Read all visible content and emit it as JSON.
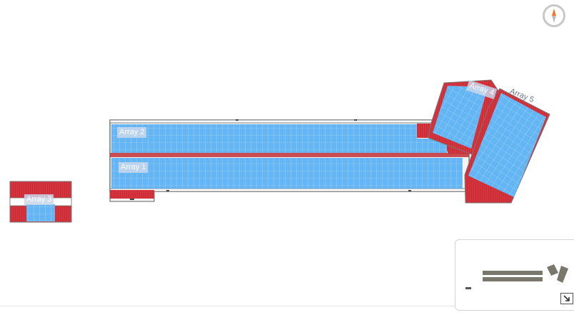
{
  "arrays": [
    {
      "label": "Array 1"
    },
    {
      "label": "Array 2"
    },
    {
      "label": "Array 3"
    },
    {
      "label": "Array 4"
    },
    {
      "label": "Array 5"
    }
  ],
  "colors": {
    "panel": "#63b6f3",
    "roof_red": "#d6333d",
    "frame": "#666666"
  },
  "icons": {
    "compass": "compass-icon",
    "expand": "expand-icon",
    "minimap_zoom": "minus-icon"
  }
}
